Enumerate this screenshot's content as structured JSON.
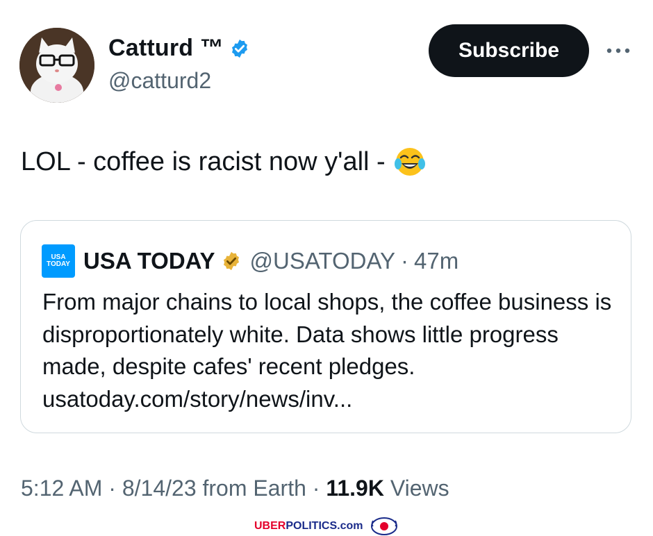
{
  "author": {
    "display_name": "Catturd ™",
    "handle": "@catturd2",
    "verified_color": "#1d9bf0"
  },
  "subscribe_label": "Subscribe",
  "more_icon": "more-horizontal-icon",
  "tweet": {
    "text": "LOL - coffee is racist now y'all -",
    "emoji": "face-with-tears-of-joy"
  },
  "quote": {
    "logo_line1": "USA",
    "logo_line2": "TODAY",
    "name": "USA TODAY",
    "verified_color": "#e8b339",
    "handle": "@USATODAY",
    "separator": "·",
    "time": "47m",
    "body": "From major chains to local shops, the coffee business is disproportionately white. Data shows little progress made, despite cafes' recent pledges. usatoday.com/story/news/inv..."
  },
  "footer": {
    "time": "5:12 AM",
    "sep1": "·",
    "date": "8/14/23",
    "source": "from Earth",
    "sep2": "·",
    "views_count": "11.9K",
    "views_label": "Views"
  },
  "watermark": {
    "part1": "UBER",
    "part2": "POLITICS.com"
  }
}
